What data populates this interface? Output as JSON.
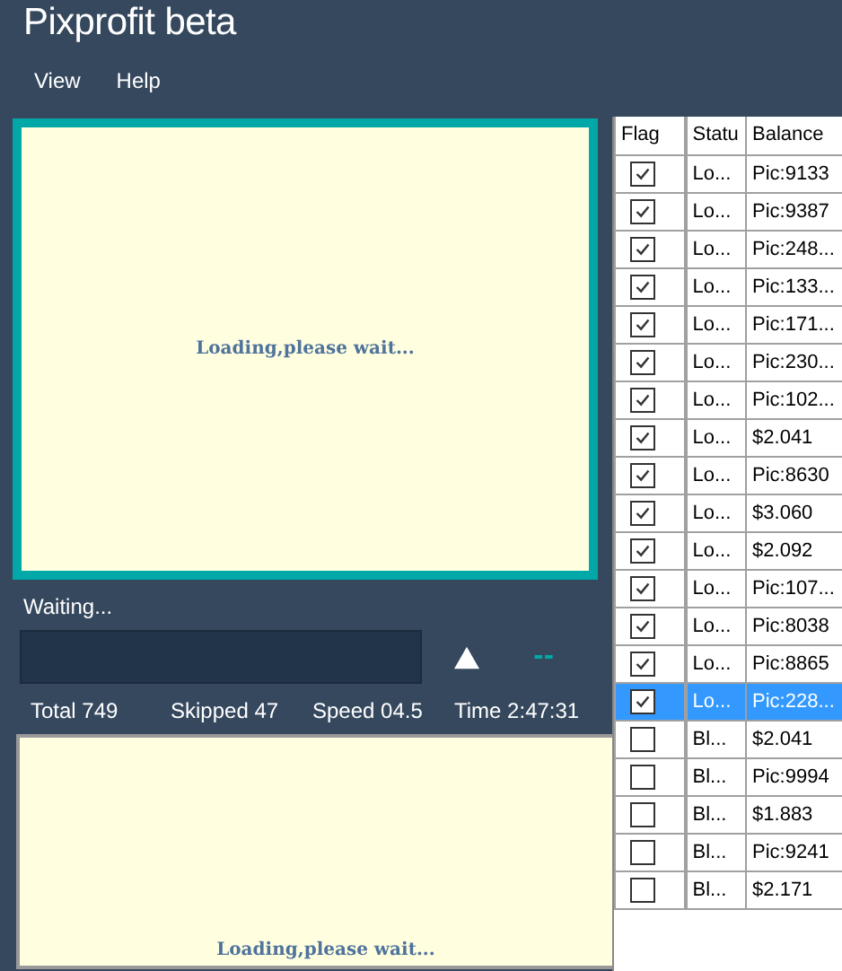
{
  "window": {
    "title": "Pixprofit beta"
  },
  "menu": [
    "View",
    "Help"
  ],
  "preview_top": {
    "message": "Loading,please wait...",
    "active": true
  },
  "status_label": "Waiting...",
  "indicator": "--",
  "stats": [
    "Total 749",
    "Skipped 47",
    "Speed 04.5",
    "Time 2:47:31"
  ],
  "preview_bottom": {
    "message": "Loading,please wait...",
    "active": false
  },
  "table": {
    "columns": [
      "Flag",
      "",
      "Statu",
      "Balance"
    ],
    "rows": [
      {
        "checked": true,
        "status": "Lo...",
        "balance": "Pic:9133",
        "selected": false
      },
      {
        "checked": true,
        "status": "Lo...",
        "balance": "Pic:9387",
        "selected": false
      },
      {
        "checked": true,
        "status": "Lo...",
        "balance": "Pic:248...",
        "selected": false
      },
      {
        "checked": true,
        "status": "Lo...",
        "balance": "Pic:133...",
        "selected": false
      },
      {
        "checked": true,
        "status": "Lo...",
        "balance": "Pic:171...",
        "selected": false
      },
      {
        "checked": true,
        "status": "Lo...",
        "balance": "Pic:230...",
        "selected": false
      },
      {
        "checked": true,
        "status": "Lo...",
        "balance": "Pic:102...",
        "selected": false
      },
      {
        "checked": true,
        "status": "Lo...",
        "balance": "$2.041",
        "selected": false
      },
      {
        "checked": true,
        "status": "Lo...",
        "balance": "Pic:8630",
        "selected": false
      },
      {
        "checked": true,
        "status": "Lo...",
        "balance": "$3.060",
        "selected": false
      },
      {
        "checked": true,
        "status": "Lo...",
        "balance": "$2.092",
        "selected": false
      },
      {
        "checked": true,
        "status": "Lo...",
        "balance": "Pic:107...",
        "selected": false
      },
      {
        "checked": true,
        "status": "Lo...",
        "balance": "Pic:8038",
        "selected": false
      },
      {
        "checked": true,
        "status": "Lo...",
        "balance": "Pic:8865",
        "selected": false
      },
      {
        "checked": true,
        "status": "Lo...",
        "balance": "Pic:228...",
        "selected": true
      },
      {
        "checked": false,
        "status": "Bl...",
        "balance": "$2.041",
        "selected": false
      },
      {
        "checked": false,
        "status": "Bl...",
        "balance": "Pic:9994",
        "selected": false
      },
      {
        "checked": false,
        "status": "Bl...",
        "balance": "$1.883",
        "selected": false
      },
      {
        "checked": false,
        "status": "Bl...",
        "balance": "Pic:9241",
        "selected": false
      },
      {
        "checked": false,
        "status": "Bl...",
        "balance": "$2.171",
        "selected": false
      }
    ]
  }
}
